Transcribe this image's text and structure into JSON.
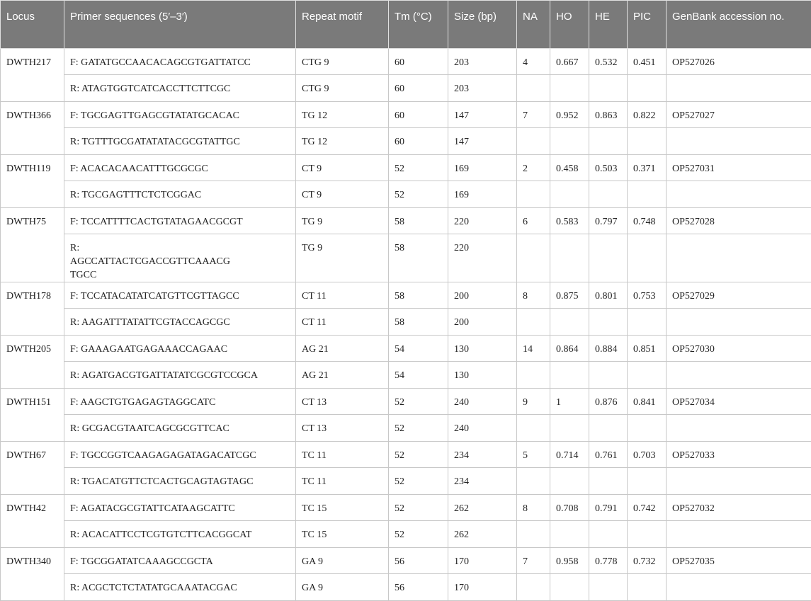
{
  "headers": [
    "Locus",
    "Primer sequences (5′–3′)",
    "Repeat motif",
    "Tm (°C)",
    "Size (bp)",
    "NA",
    "HO",
    "HE",
    "PIC",
    "GenBank accession no."
  ],
  "rows": [
    {
      "locus": "DWTH217",
      "f": {
        "seq": "F: GATATGCCAACACAGCGTGATTATCC",
        "motif": "CTG 9",
        "tm": "60",
        "size": "203"
      },
      "r": {
        "seq": "R: ATAGTGGTCATCACCTTCTTCGC",
        "motif": "CTG 9",
        "tm": "60",
        "size": "203"
      },
      "na": "4",
      "ho": "0.667",
      "he": "0.532",
      "pic": "0.451",
      "acc": "OP527026"
    },
    {
      "locus": "DWTH366",
      "f": {
        "seq": "F: TGCGAGTTGAGCGTATATGCACAC",
        "motif": "TG 12",
        "tm": "60",
        "size": "147"
      },
      "r": {
        "seq": "R: TGTTTGCGATATATACGCGTATTGC",
        "motif": "TG 12",
        "tm": "60",
        "size": "147"
      },
      "na": "7",
      "ho": "0.952",
      "he": "0.863",
      "pic": "0.822",
      "acc": "OP527027"
    },
    {
      "locus": "DWTH119",
      "f": {
        "seq": "F: ACACACAACATTTGCGCGC",
        "motif": "CT 9",
        "tm": "52",
        "size": "169"
      },
      "r": {
        "seq": "R: TGCGAGTTTCTCTCGGAC",
        "motif": "CT 9",
        "tm": "52",
        "size": "169"
      },
      "na": "2",
      "ho": "0.458",
      "he": "0.503",
      "pic": "0.371",
      "acc": "OP527031"
    },
    {
      "locus": "DWTH75",
      "f": {
        "seq": "F: TCCATTTTCACTGTATAGAACGCGT",
        "motif": "TG 9",
        "tm": "58",
        "size": "220"
      },
      "r": {
        "seq": "R: AGCCATTACTCGACCGTTCAAACG TGCC",
        "motif": "TG 9",
        "tm": "58",
        "size": "220"
      },
      "na": "6",
      "ho": "0.583",
      "he": "0.797",
      "pic": "0.748",
      "acc": "OP527028"
    },
    {
      "locus": "DWTH178",
      "f": {
        "seq": "F: TCCATACATATCATGTTCGTTAGCC",
        "motif": "CT 11",
        "tm": "58",
        "size": "200"
      },
      "r": {
        "seq": "R: AAGATTTATATTCGTACCAGCGC",
        "motif": "CT 11",
        "tm": "58",
        "size": "200"
      },
      "na": "8",
      "ho": "0.875",
      "he": "0.801",
      "pic": "0.753",
      "acc": "OP527029"
    },
    {
      "locus": "DWTH205",
      "f": {
        "seq": "F: GAAAGAATGAGAAACCAGAAC",
        "motif": "AG 21",
        "tm": "54",
        "size": "130"
      },
      "r": {
        "seq": "R: AGATGACGTGATTATATCGCGTCCGCA",
        "motif": "AG 21",
        "tm": "54",
        "size": "130"
      },
      "na": "14",
      "ho": "0.864",
      "he": "0.884",
      "pic": "0.851",
      "acc": "OP527030"
    },
    {
      "locus": "DWTH151",
      "f": {
        "seq": "F: AAGCTGTGAGAGTAGGCATC",
        "motif": "CT 13",
        "tm": "52",
        "size": "240"
      },
      "r": {
        "seq": "R: GCGACGTAATCAGCGCGTTCAC",
        "motif": "CT 13",
        "tm": "52",
        "size": "240"
      },
      "na": "9",
      "ho": "1",
      "he": "0.876",
      "pic": "0.841",
      "acc": "OP527034"
    },
    {
      "locus": "DWTH67",
      "f": {
        "seq": "F: TGCCGGTCAAGAGAGATAGACATCGC",
        "motif": "TC 11",
        "tm": "52",
        "size": "234"
      },
      "r": {
        "seq": "R: TGACATGTTCTCACTGCAGTAGTAGC",
        "motif": "TC 11",
        "tm": "52",
        "size": "234"
      },
      "na": "5",
      "ho": "0.714",
      "he": "0.761",
      "pic": "0.703",
      "acc": "OP527033"
    },
    {
      "locus": "DWTH42",
      "f": {
        "seq": "F: AGATACGCGTATTCATAAGCATTC",
        "motif": "TC 15",
        "tm": "52",
        "size": "262"
      },
      "r": {
        "seq": "R: ACACATTCCTCGTGTCTTCACGGCAT",
        "motif": "TC 15",
        "tm": "52",
        "size": "262"
      },
      "na": "8",
      "ho": "0.708",
      "he": "0.791",
      "pic": "0.742",
      "acc": "OP527032"
    },
    {
      "locus": "DWTH340",
      "f": {
        "seq": "F: TGCGGATATCAAAGCCGCTA",
        "motif": "GA 9",
        "tm": "56",
        "size": "170"
      },
      "r": {
        "seq": "R: ACGCTCTCTATATGCAAATACGAC",
        "motif": "GA 9",
        "tm": "56",
        "size": "170"
      },
      "na": "7",
      "ho": "0.958",
      "he": "0.778",
      "pic": "0.732",
      "acc": "OP527035"
    }
  ]
}
